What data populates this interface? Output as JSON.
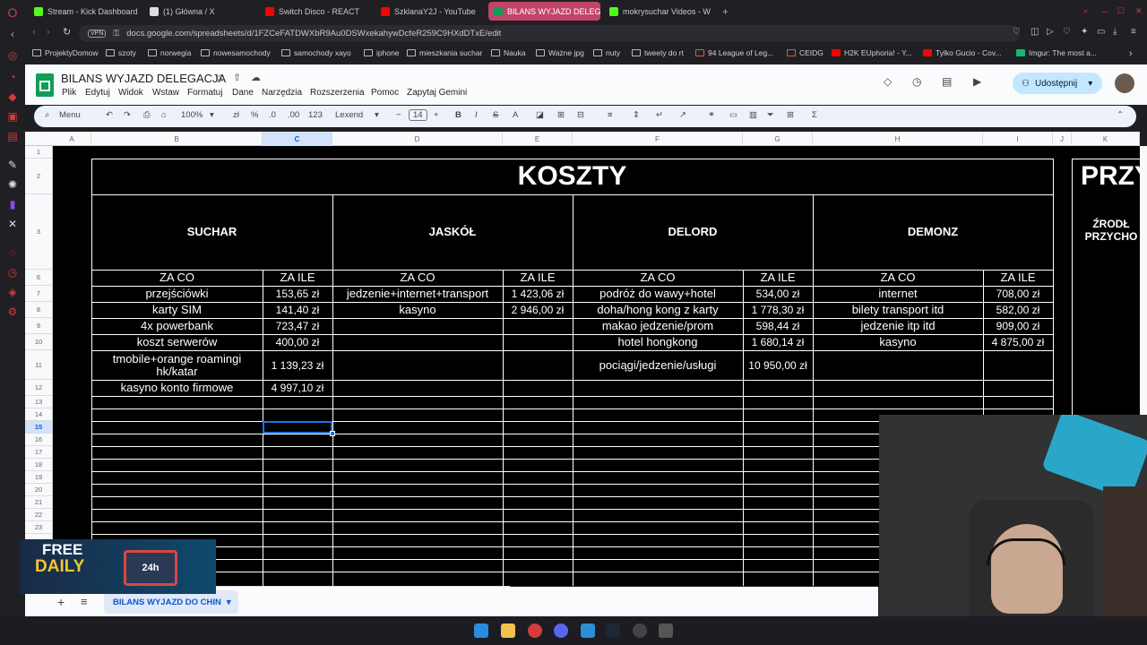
{
  "browser": {
    "tabs": [
      {
        "label": "Stream - Kick Dashboard",
        "color": "#53fc18"
      },
      {
        "label": "(1) Główna / X",
        "color": "#dddddd"
      },
      {
        "label": "Switch Disco - REACT",
        "color": "#ff0000"
      },
      {
        "label": "SzklanaY2J - YouTube",
        "color": "#ff0000"
      },
      {
        "label": "BILANS WYJAZD DELEGA",
        "color": "#0f9d58"
      },
      {
        "label": "mokrysuchar Videos - W",
        "color": "#53fc18"
      }
    ],
    "vpn": "VPN",
    "url": "docs.google.com/spreadsheets/d/1FZCeFATDWXbR9Au0DSWxekahywDcfeR259C9HXdDTxE/edit",
    "bookmarks": [
      "ProjektyDomow",
      "szoty",
      "norwegia",
      "nowesamochody",
      "samochody xayo",
      "iphone",
      "mieszkania suchar",
      "Nauka",
      "Ważne jpg",
      "nuty",
      "tweety do rt",
      "94 League of Leg...",
      "CEIDG",
      "H2K EUphoria! - Y...",
      "Tylko Gucio - Cov...",
      "Imgur: The most a..."
    ]
  },
  "sheets": {
    "title": "BILANS WYJAZD DELEGACJA",
    "menus": [
      "Plik",
      "Edytuj",
      "Widok",
      "Wstaw",
      "Formatuj",
      "Dane",
      "Narzędzia",
      "Rozszerzenia",
      "Pomoc",
      "Zapytaj Gemini"
    ],
    "share_label": "Udostępnij",
    "toolbar": {
      "menu_label": "Menu",
      "zoom": "100%",
      "currency": "zł",
      "percent": "%",
      "dec_minus": ".0",
      "dec_plus": ".00",
      "number_fmt": "123",
      "font": "Lexend",
      "font_size": "14",
      "bold": "B",
      "italic": "I",
      "strike": "S",
      "textcolor": "A"
    },
    "columns": [
      "A",
      "B",
      "C",
      "D",
      "E",
      "F",
      "G",
      "H",
      "I",
      "J",
      "K"
    ],
    "rows": [
      "1",
      "2",
      "3",
      "6",
      "7",
      "8",
      "9",
      "10",
      "11",
      "12",
      "13",
      "14",
      "15",
      "16",
      "17",
      "18",
      "19",
      "20",
      "21",
      "22",
      "23"
    ],
    "main_title": "KOSZTY",
    "right_title": "PRZY",
    "right_sub": "ŹRODŁ PRZYCHO",
    "people": [
      "SUCHAR",
      "JASKÓŁ",
      "DELORD",
      "DEMONZ"
    ],
    "col_za_co": "ZA CO",
    "col_za_ile": "ZA ILE",
    "suchar": [
      [
        "przejściówki",
        "153,65 zł"
      ],
      [
        "karty SIM",
        "141,40 zł"
      ],
      [
        "4x powerbank",
        "723,47 zł"
      ],
      [
        "koszt serwerów",
        "400,00 zł"
      ],
      [
        "tmobile+orange roamingi hk/katar",
        "1 139,23 zł"
      ],
      [
        "kasyno konto firmowe",
        "4 997,10 zł"
      ]
    ],
    "jaskol": [
      [
        "jedzenie+internet+transport",
        "1 423,06 zł"
      ],
      [
        "kasyno",
        "2 946,00 zł"
      ]
    ],
    "delord": [
      [
        "podróż do wawy+hotel",
        "534,00 zł"
      ],
      [
        "doha/hong kong z karty",
        "1 778,30 zł"
      ],
      [
        "makao jedzenie/prom",
        "598,44 zł"
      ],
      [
        "hotel hongkong",
        "1 680,14 zł"
      ],
      [
        "pociągi/jedzenie/usługi",
        "10 950,00 zł"
      ]
    ],
    "demonz": [
      [
        "internet",
        "708,00 zł"
      ],
      [
        "bilety transport itd",
        "582,00 zł"
      ],
      [
        "jedzenie itp itd",
        "909,00 zł"
      ],
      [
        "kasyno",
        "4 875,00 zł"
      ]
    ],
    "sheet_tab": "BILANS WYJAZD DO CHIN"
  },
  "promo": {
    "line1": "FREE",
    "line2": "DAILY",
    "badge": "24h"
  },
  "colors": {
    "accent": "#c2e7ff",
    "active_tab": "#c1446a",
    "sheet_green": "#0f9d58"
  }
}
